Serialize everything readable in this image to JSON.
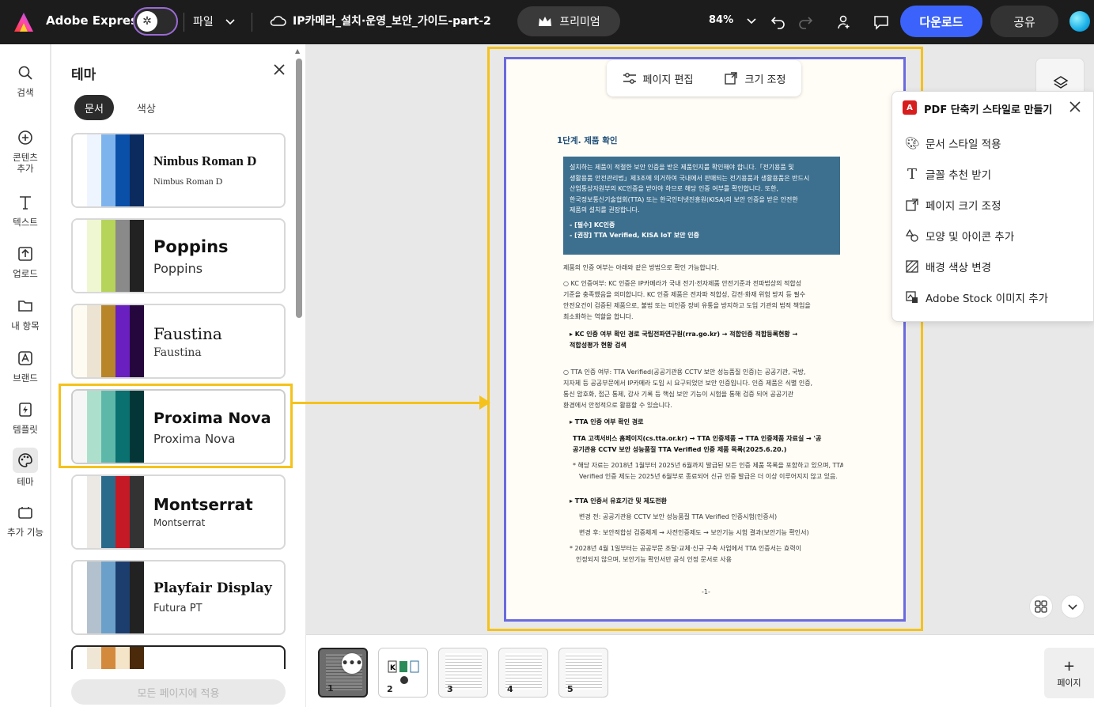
{
  "topbar": {
    "brand": "Adobe Express",
    "file_menu": "파일",
    "doc_title": "IP카메라_설치·운영_보안_가이드-part-2",
    "premium": "프리미엄",
    "zoom": "84%",
    "download": "다운로드",
    "share": "공유"
  },
  "rail": {
    "items": [
      {
        "label": "검색",
        "icon": "search-icon"
      },
      {
        "label": "콘텐츠 추가",
        "icon": "plus-circle-icon"
      },
      {
        "label": "텍스트",
        "icon": "text-icon"
      },
      {
        "label": "업로드",
        "icon": "upload-icon"
      },
      {
        "label": "내 항목",
        "icon": "folder-icon"
      },
      {
        "label": "브랜드",
        "icon": "brand-icon"
      },
      {
        "label": "템플릿",
        "icon": "template-icon"
      },
      {
        "label": "테마",
        "icon": "palette-icon"
      },
      {
        "label": "추가 기능",
        "icon": "addons-icon"
      }
    ]
  },
  "panel": {
    "title": "테마",
    "tabs": [
      "문서",
      "색상"
    ],
    "themes": [
      {
        "name": "Nimbus Roman D",
        "sub": "Nimbus Roman D",
        "colors": [
          "#ffffff",
          "#eef5fe",
          "#7eb4ee",
          "#0a4fa8",
          "#0b2a5e"
        ]
      },
      {
        "name": "Poppins",
        "sub": "Poppins",
        "colors": [
          "#ffffff",
          "#eef7d2",
          "#b6d35a",
          "#8a8a8a",
          "#222222"
        ]
      },
      {
        "name": "Faustina",
        "sub": "Faustina",
        "colors": [
          "#fdfbf2",
          "#ece3d3",
          "#b88528",
          "#6a1fc0",
          "#25073d"
        ]
      },
      {
        "name": "Proxima Nova",
        "sub": "Proxima Nova",
        "colors": [
          "#f6f6f6",
          "#ade0cc",
          "#5eb8aa",
          "#0a7070",
          "#053637"
        ]
      },
      {
        "name": "Montserrat",
        "sub": "Montserrat",
        "colors": [
          "#ffffff",
          "#ece9e5",
          "#2a6b8c",
          "#c51a26",
          "#333333"
        ]
      },
      {
        "name": "Playfair Display",
        "sub": "Futura PT",
        "colors": [
          "#ffffff",
          "#b2c1cd",
          "#6ba0cb",
          "#1c3e6e",
          "#222222"
        ]
      }
    ],
    "apply_all": "모든 페이지에 적용"
  },
  "canvas": {
    "toolbar_edit": "페이지 편집",
    "toolbar_resize": "크기 조정",
    "page_heading": "1단계. 제품 확인",
    "box_lines": [
      "설치하는 제품이 적절한 보안 인증을 받은 제품인지를 확인해야 합니다.「전기용품 및",
      "생활용품 안전관리법」제3조에 의거하여 국내에서 판매되는 전기용품과 생활용품은 반드시",
      "산업통상자원부의 KC인증을 받아야 하므로 해당 인증 여부를 확인합니다. 또한,",
      "한국정보통신기술협회(TTA) 또는 한국인터넷진흥원(KISA)의 보안 인증을 받은 안전한",
      "제품의 설치를 권장합니다."
    ],
    "box_bullets": [
      "- [필수] KC인증",
      "- [권장] TTA Verified, KISA IoT 보안 인증"
    ],
    "body_lines": [
      "제품의 인증 여부는 아래와 같은 방법으로 확인 가능합니다.",
      "○ KC 인증여부: KC 인증은 IP카메라가 국내 전기·전자제품 안전기준과 전파법상의 적합성",
      "기준을 충족했음을 의미합니다. KC 인증 제품은 전자파 적합성, 감전·화재 위험 방지 등 필수",
      "안전요건이 검증된 제품으로, 불법 또는 미인증 장비 유통을 방지하고 도입 기관의 법적 책임을",
      "최소화하는 역할을 합니다.",
      "▸ KC 인증 여부 확인 경로 국립전파연구원(rra.go.kr) → 적합인증 적합등록현황 →",
      "적합성평가 현황 검색",
      "○ TTA 인증 여부: TTA Verified(공공기관용 CCTV 보안 성능품질 인증)는 공공기관, 국방,",
      "지자체 등 공공부문에서 IP카메라 도입 시 요구되었던 보안 인증입니다. 인증 제품은 식별 인증,",
      "통신 암호화, 접근 통제, 감사 기록 등 핵심 보안 기능이 시험을 통해 검증 되어 공공기관",
      "환경에서 안정적으로 활용할 수 있습니다.",
      "▸ TTA 인증 여부 확인 경로",
      "TTA 고객서비스 홈페이지(cs.tta.or.kr) → TTA 인증제품 → TTA 인증제품 자료실 → '공",
      "공기관용 CCTV 보안 성능품질 TTA Verified 인증 제품 목록(2025.6.20.)",
      "* 해당 자료는 2018년 1월부터 2025년 6월까지 발급된 모든 인증 제품 목록을 포함하고 있으며, TTA",
      "Verified 인증 제도는 2025년 6월부로 종료되어 신규 인증 발급은 더 이상 이루어지지 않고 있음.",
      "▸ TTA 인증서 유효기간 및 제도전환",
      "변경 전: 공공기관용 CCTV 보안 성능품질 TTA Verified 인증시험(인증서)",
      "변경 후: 보안적합성 검증체계 → 사전인증제도 → 보안기능 시험 결과(보안기능 확인서)",
      "* 2028년 4월 1일부터는 공공부문 조달·교체·신규 구축 사업에서 TTA 인증서는 효력이",
      "인정되지 않으며, 보안기능 확인서만 공식 인정 문서로 사용"
    ],
    "page_number": "-1-"
  },
  "popup": {
    "title": "PDF 단축키 스타일로 만들기",
    "items": [
      {
        "label": "문서 스타일 적용",
        "icon": "palette-icon"
      },
      {
        "label": "글꼴 추천 받기",
        "icon": "font-icon"
      },
      {
        "label": "페이지 크기 조정",
        "icon": "resize-icon"
      },
      {
        "label": "모양 및 아이콘 추가",
        "icon": "shapes-icon"
      },
      {
        "label": "배경 색상 변경",
        "icon": "background-icon"
      },
      {
        "label": "Adobe Stock 이미지 추가",
        "icon": "stock-image-icon"
      }
    ]
  },
  "pages": {
    "numbers": [
      "1",
      "2",
      "3",
      "4",
      "5"
    ],
    "more": "•••",
    "add_label": "페이지",
    "add_plus": "+"
  },
  "colors": {
    "accent": "#3b63fb",
    "highlight": "#f5c21b",
    "page_border": "#6a6adf"
  }
}
